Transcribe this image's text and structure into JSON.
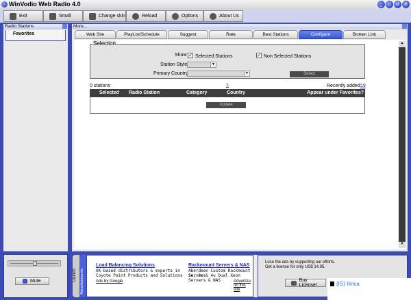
{
  "window": {
    "title": "WinVodio Web Radio 4.0",
    "controls": [
      "_",
      "□",
      "↺",
      "✕"
    ]
  },
  "toolbar": [
    {
      "label": "Exit",
      "icon": "exit-icon"
    },
    {
      "label": "Small",
      "icon": "small-icon"
    },
    {
      "label": "Change skin",
      "icon": "skin-icon"
    },
    {
      "label": "Reload",
      "icon": "reload-icon"
    },
    {
      "label": "Options",
      "icon": "options-icon"
    },
    {
      "label": "About Us",
      "icon": "about-icon"
    }
  ],
  "left_panel": {
    "title": "Radio Stations",
    "items": [
      "Favorites"
    ]
  },
  "right_panel": {
    "title": "More..."
  },
  "tabs": [
    "Web Site",
    "PlayList/Schedule",
    "Suggest",
    "Rate",
    "Best Stations",
    "Configure",
    "Broken Link"
  ],
  "selection": {
    "legend": "Selection",
    "show_label": "Show",
    "selected_stations": "Selected Stations",
    "non_selected_stations": "Non Selected Stations",
    "station_style_label": "Station Style",
    "primary_country_label": "Primary Country",
    "select_button": "Select",
    "check": "✓"
  },
  "results": {
    "count": "0 stations",
    "page": "1",
    "recently_label": "Recently added:",
    "recently_value": "19"
  },
  "table": {
    "columns": [
      "Selected",
      "Radio Station",
      "Category",
      "Country",
      "Appear under Favorites?"
    ],
    "update_button": "Update"
  },
  "player": {
    "mute": "Mute"
  },
  "side_tabs": [
    "Launch",
    "Advertisements"
  ],
  "ads": [
    {
      "title": "Load Balancing Solutions",
      "lines": [
        "UK-based distributors & experts in",
        "Coyote Point Products and Solutions"
      ]
    },
    {
      "title": "Rackmount Servers & NAS",
      "lines": [
        "Aberdeen Custom Rackmount Servers",
        "1u, 2u & 4u Dual Xeon Servers & NAS"
      ]
    }
  ],
  "ads_by": "Ads by Google",
  "advertise": "Advertize on this site",
  "license": {
    "line1": "Lose the ads by supporting our efforts.",
    "line2": "Get a license for only US$ 14.95.",
    "button": "Buy License!"
  },
  "watermark": "(IS) Ilinca"
}
